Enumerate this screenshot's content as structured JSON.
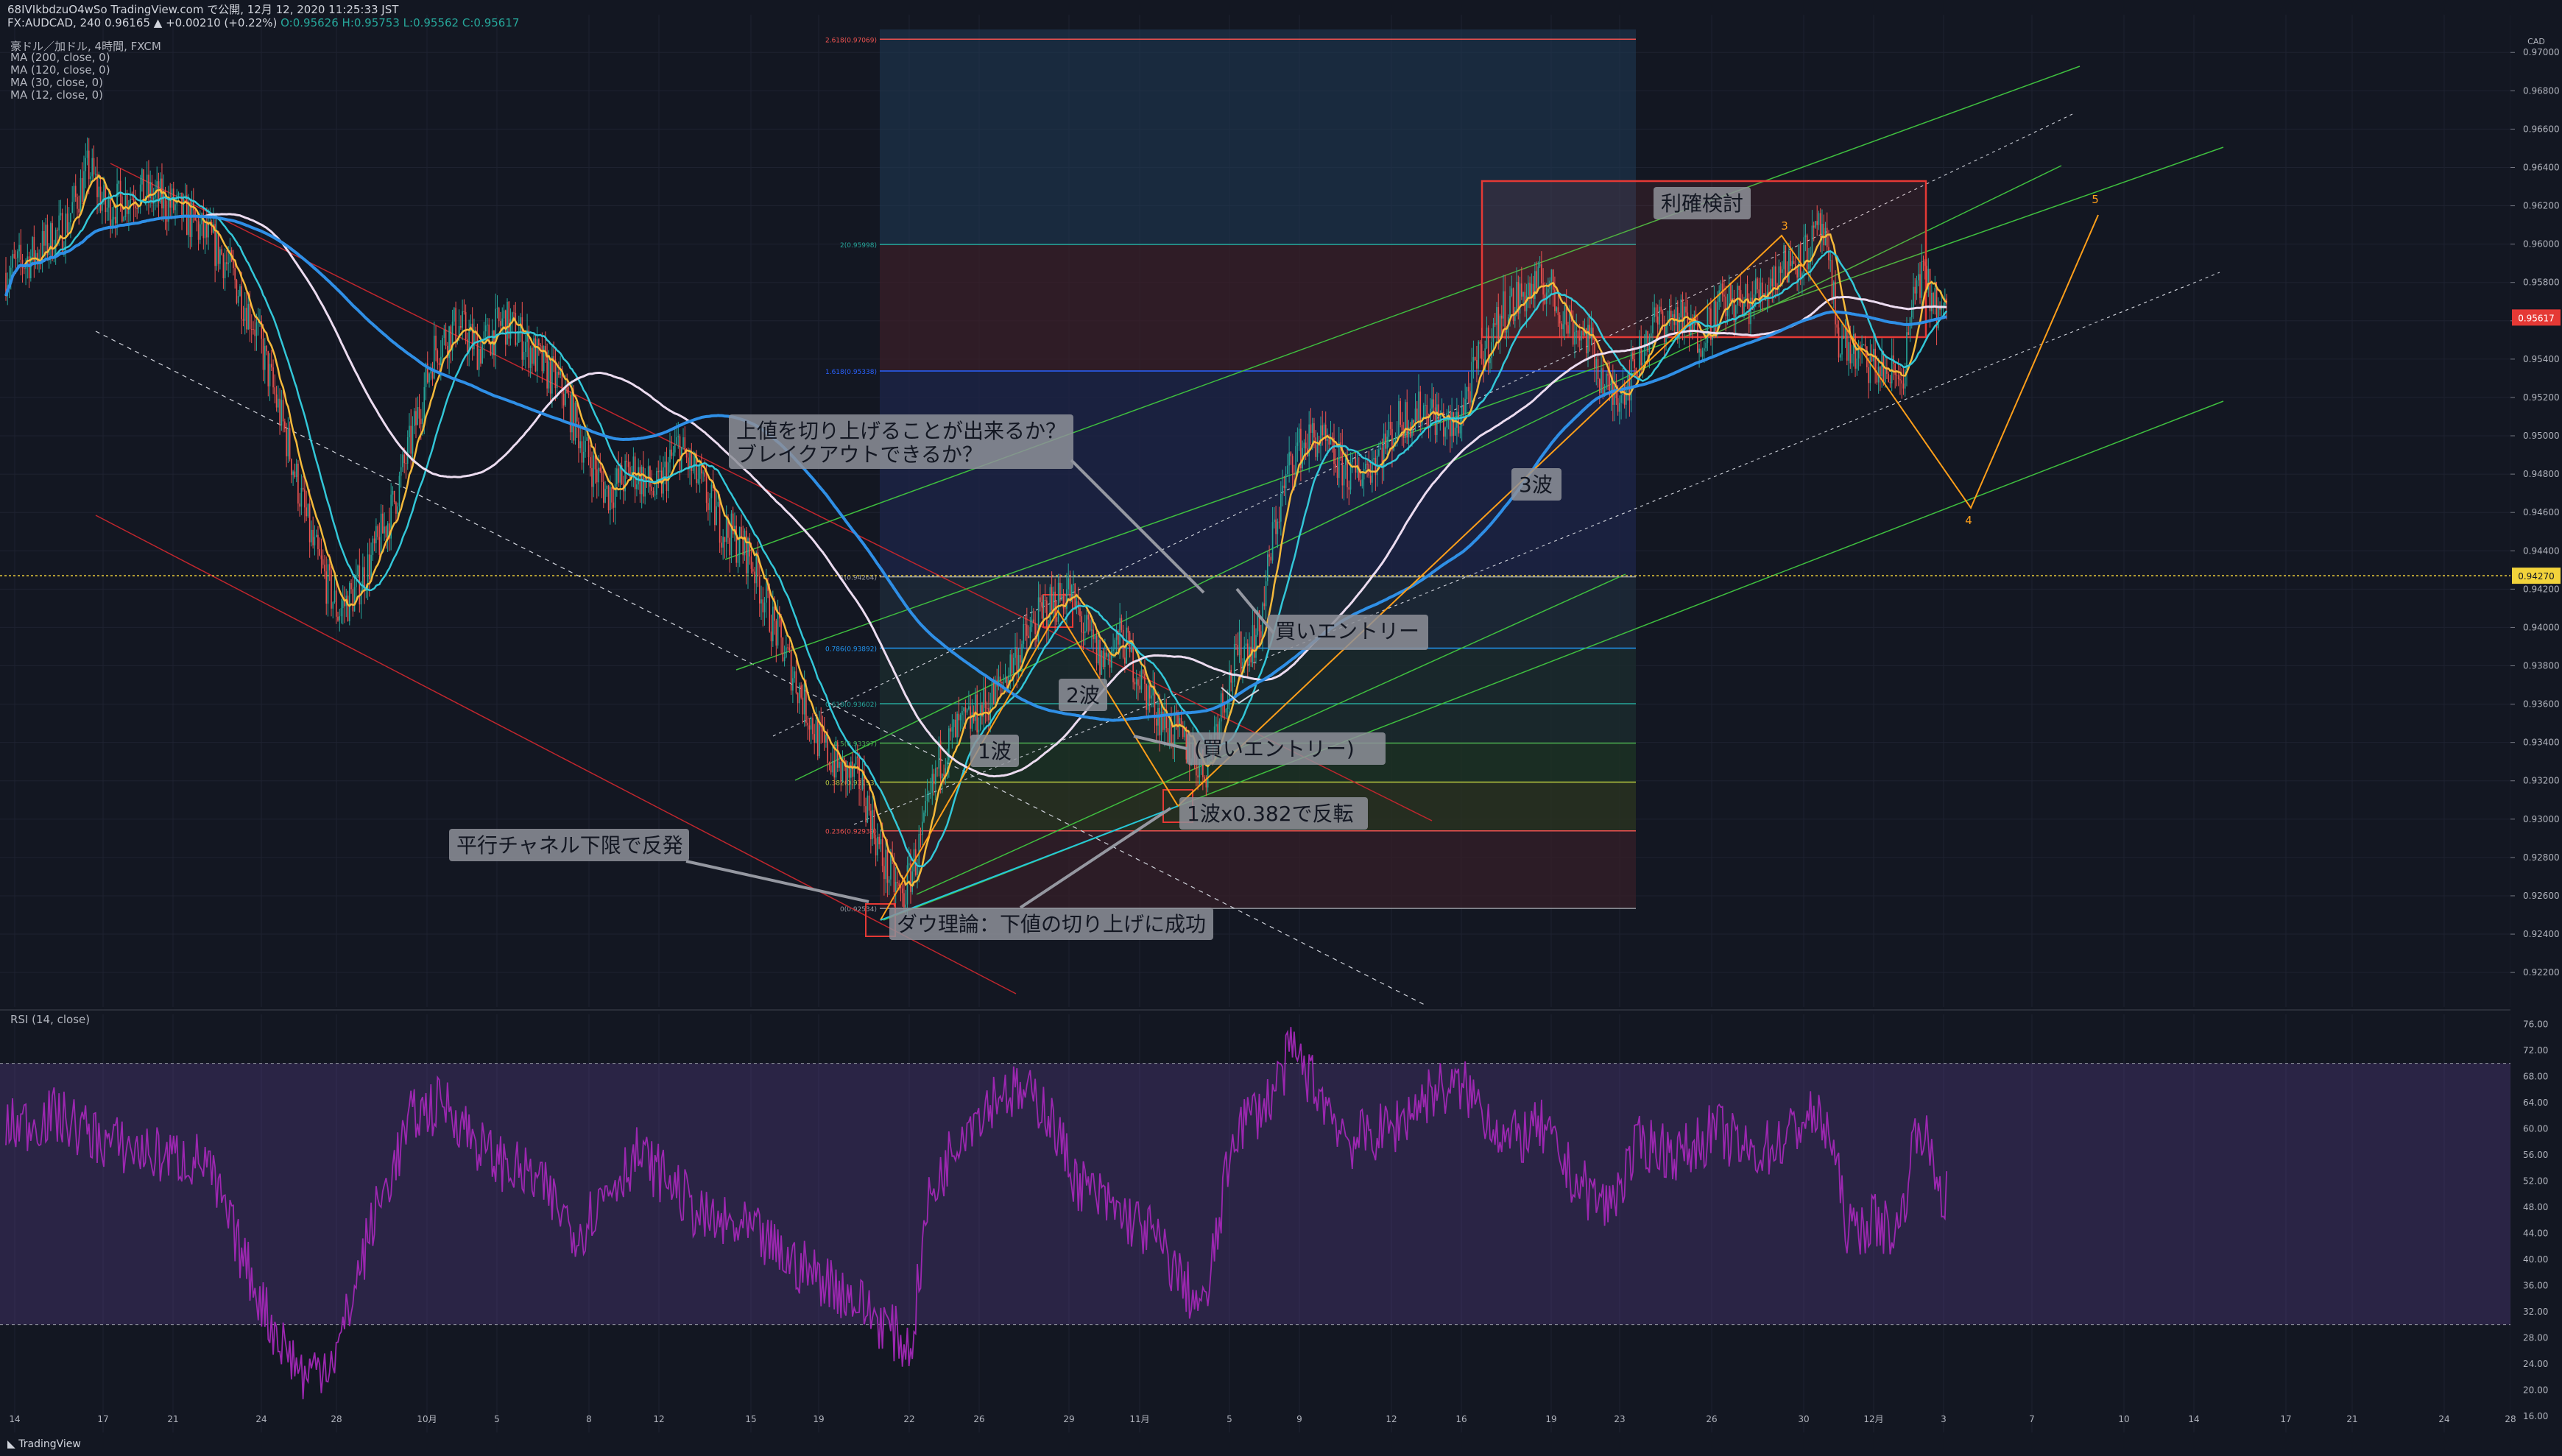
{
  "header": {
    "line1": "68IVIkbdzuO4wSo TradingView.com で公開, 12月 12, 2020 11:25:33 JST",
    "symbol_line": "FX:AUDCAD, 240 0.96165 ▲ +0.00210 (+0.22%)",
    "ohlc": "O:0.95626 H:0.95753 L:0.95562 C:0.95617",
    "studies": [
      "豪ドル／加ドル, 4時間, FXCM",
      "MA (200, close, 0)",
      "MA (120, close, 0)",
      "MA (30, close, 0)",
      "MA (12, close, 0)"
    ],
    "rsi_label": "RSI (14, close)"
  },
  "footer": {
    "brand": "TradingView"
  },
  "colors": {
    "bg": "#131722",
    "grid": "#1e2230",
    "up": "#26a69a",
    "down": "#ef5350",
    "ma200": "#2f8fe6",
    "ma120": "#ecdcf0",
    "ma30": "#33c7d8",
    "ma12": "#f5b93b",
    "channel_red": "#c0262d",
    "channel_green": "#3fbf3f",
    "rsi": "#9c27b0",
    "wave": "#ff9f1a",
    "price_tag": "#e53935",
    "level_tag": "#f2d33b"
  },
  "chart_data": [
    {
      "type": "line",
      "title": "豪ドル／加ドル, 4時間, FXCM",
      "price_axis_currency": "CAD",
      "x_axis_ticks": [
        "14",
        "17",
        "21",
        "24",
        "28",
        "10月",
        "5",
        "8",
        "12",
        "15",
        "19",
        "22",
        "26",
        "29",
        "11月",
        "5",
        "9",
        "12",
        "16",
        "19",
        "23",
        "26",
        "30",
        "12月",
        "3",
        "7",
        "10",
        "14",
        "17",
        "21",
        "24",
        "28"
      ],
      "y_axis_ticks": [
        "0.97000",
        "0.96800",
        "0.96600",
        "0.96400",
        "0.96200",
        "0.96000",
        "0.95800",
        "0.95600",
        "0.95400",
        "0.95200",
        "0.95000",
        "0.94800",
        "0.94600",
        "0.94400",
        "0.94200",
        "0.94000",
        "0.93800",
        "0.93600",
        "0.93400",
        "0.93200",
        "0.93000",
        "0.92800",
        "0.92600",
        "0.92400",
        "0.92200"
      ],
      "ylim": [
        0.9202,
        0.9712
      ],
      "current_price_tag": "0.95617",
      "horizontal_level_tag": "0.94270",
      "fib_levels": [
        {
          "label": "2.618(0.97069)",
          "value": 0.97069
        },
        {
          "label": "2(0.95998)",
          "value": 0.95998
        },
        {
          "label": "1.618(0.95338)",
          "value": 0.95338
        },
        {
          "label": "1(0.94264)",
          "value": 0.94264
        },
        {
          "label": "0.786(0.93892)",
          "value": 0.93892
        },
        {
          "label": "0.618(0.93602)",
          "value": 0.93602
        },
        {
          "label": "0.5(0.93397)",
          "value": 0.93397
        },
        {
          "label": "0.382(0.93193)",
          "value": 0.93193
        },
        {
          "label": "0.236(0.92939)",
          "value": 0.92939
        },
        {
          "label": "0(0.92534)",
          "value": 0.92534
        }
      ],
      "price_series": {
        "name": "AUDCAD",
        "anchors": [
          [
            0,
            0.9585
          ],
          [
            18,
            0.9595
          ],
          [
            35,
            0.9608
          ],
          [
            50,
            0.964
          ],
          [
            60,
            0.9618
          ],
          [
            80,
            0.9628
          ],
          [
            100,
            0.962
          ],
          [
            112,
            0.9612
          ],
          [
            130,
            0.9595
          ],
          [
            150,
            0.9558
          ],
          [
            168,
            0.9502
          ],
          [
            185,
            0.9442
          ],
          [
            200,
            0.9408
          ],
          [
            210,
            0.9418
          ],
          [
            220,
            0.9435
          ],
          [
            232,
            0.946
          ],
          [
            245,
            0.95
          ],
          [
            258,
            0.9545
          ],
          [
            272,
            0.9558
          ],
          [
            285,
            0.9545
          ],
          [
            300,
            0.956
          ],
          [
            310,
            0.9552
          ],
          [
            322,
            0.9538
          ],
          [
            335,
            0.9525
          ],
          [
            350,
            0.949
          ],
          [
            362,
            0.947
          ],
          [
            378,
            0.9482
          ],
          [
            392,
            0.947
          ],
          [
            405,
            0.9495
          ],
          [
            418,
            0.9475
          ],
          [
            432,
            0.9452
          ],
          [
            448,
            0.9438
          ],
          [
            462,
            0.9402
          ],
          [
            476,
            0.9372
          ],
          [
            490,
            0.934
          ],
          [
            503,
            0.9325
          ],
          [
            515,
            0.932
          ],
          [
            528,
            0.9278
          ],
          [
            540,
            0.9258
          ],
          [
            552,
            0.929
          ],
          [
            562,
            0.933
          ],
          [
            572,
            0.9345
          ],
          [
            582,
            0.9352
          ],
          [
            596,
            0.9365
          ],
          [
            610,
            0.9388
          ],
          [
            625,
            0.9408
          ],
          [
            640,
            0.942
          ],
          [
            650,
            0.9398
          ],
          [
            660,
            0.9382
          ],
          [
            672,
            0.9395
          ],
          [
            685,
            0.937
          ],
          [
            698,
            0.935
          ],
          [
            710,
            0.934
          ],
          [
            722,
            0.9325
          ],
          [
            732,
            0.936
          ],
          [
            742,
            0.9385
          ],
          [
            755,
            0.9398
          ],
          [
            764,
            0.9452
          ],
          [
            775,
            0.949
          ],
          [
            788,
            0.95
          ],
          [
            800,
            0.9488
          ],
          [
            812,
            0.9478
          ],
          [
            826,
            0.949
          ],
          [
            840,
            0.9508
          ],
          [
            856,
            0.9515
          ],
          [
            872,
            0.9502
          ],
          [
            888,
            0.954
          ],
          [
            902,
            0.9565
          ],
          [
            916,
            0.9575
          ],
          [
            928,
            0.958
          ],
          [
            940,
            0.956
          ],
          [
            952,
            0.9552
          ],
          [
            966,
            0.952
          ],
          [
            978,
            0.953
          ],
          [
            992,
            0.9558
          ],
          [
            1006,
            0.9562
          ],
          [
            1020,
            0.9552
          ],
          [
            1034,
            0.957
          ],
          [
            1048,
            0.9568
          ],
          [
            1060,
            0.9578
          ],
          [
            1072,
            0.959
          ],
          [
            1084,
            0.9595
          ],
          [
            1094,
            0.9608
          ],
          [
            1104,
            0.9552
          ],
          [
            1116,
            0.954
          ],
          [
            1128,
            0.9535
          ],
          [
            1142,
            0.953
          ],
          [
            1152,
            0.9585
          ],
          [
            1166,
            0.9562
          ]
        ]
      },
      "moving_averages": [
        {
          "name": "MA (12, close, 0)",
          "period": 12
        },
        {
          "name": "MA (30, close, 0)",
          "period": 30
        },
        {
          "name": "MA (120, close, 0)",
          "period": 120
        },
        {
          "name": "MA (200, close, 0)",
          "period": 200
        }
      ],
      "wave_labels": [
        "3",
        "4",
        "5"
      ],
      "annotations": [
        "上値を切り上げることが出来るか？\nブレイクアウトできるか？",
        "買いエントリー",
        "2波",
        "1波",
        "(買いエントリー)",
        "1波x0.382で反転",
        "平行チャネル下限で反発",
        "ダウ理論：下値の切り上げに成功",
        "3波",
        "利確検討"
      ]
    },
    {
      "type": "line",
      "title": "RSI (14, close)",
      "y_axis_ticks": [
        "76.00",
        "72.00",
        "68.00",
        "64.00",
        "60.00",
        "56.00",
        "52.00",
        "48.00",
        "44.00",
        "40.00",
        "36.00",
        "32.00",
        "28.00",
        "24.00",
        "20.00",
        "16.00"
      ],
      "ylim": [
        13.5,
        77.5
      ],
      "band": [
        30,
        70
      ],
      "series": {
        "name": "RSI (14, close)",
        "anchors": [
          [
            0,
            60
          ],
          [
            30,
            62
          ],
          [
            60,
            58
          ],
          [
            90,
            56
          ],
          [
            120,
            55
          ],
          [
            140,
            42
          ],
          [
            160,
            30
          ],
          [
            180,
            22
          ],
          [
            200,
            26
          ],
          [
            220,
            45
          ],
          [
            245,
            62
          ],
          [
            265,
            64
          ],
          [
            290,
            56
          ],
          [
            320,
            52
          ],
          [
            345,
            44
          ],
          [
            360,
            50
          ],
          [
            380,
            56
          ],
          [
            400,
            52
          ],
          [
            420,
            46
          ],
          [
            450,
            44
          ],
          [
            470,
            40
          ],
          [
            500,
            36
          ],
          [
            530,
            30
          ],
          [
            545,
            26
          ],
          [
            555,
            48
          ],
          [
            575,
            60
          ],
          [
            600,
            66
          ],
          [
            625,
            64
          ],
          [
            645,
            52
          ],
          [
            665,
            48
          ],
          [
            690,
            44
          ],
          [
            710,
            36
          ],
          [
            722,
            32
          ],
          [
            740,
            60
          ],
          [
            760,
            64
          ],
          [
            775,
            72
          ],
          [
            790,
            66
          ],
          [
            810,
            58
          ],
          [
            835,
            60
          ],
          [
            860,
            66
          ],
          [
            880,
            66
          ],
          [
            905,
            58
          ],
          [
            925,
            60
          ],
          [
            945,
            52
          ],
          [
            965,
            48
          ],
          [
            985,
            58
          ],
          [
            1010,
            56
          ],
          [
            1030,
            60
          ],
          [
            1050,
            56
          ],
          [
            1070,
            58
          ],
          [
            1085,
            62
          ],
          [
            1098,
            60
          ],
          [
            1110,
            44
          ],
          [
            1125,
            46
          ],
          [
            1140,
            44
          ],
          [
            1152,
            62
          ],
          [
            1166,
            50
          ]
        ]
      }
    }
  ]
}
